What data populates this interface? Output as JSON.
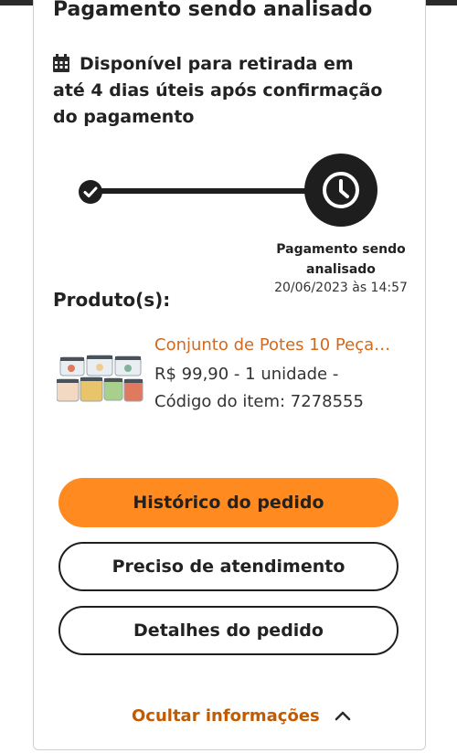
{
  "status": {
    "title": "Pagamento sendo analisado",
    "availability": "Disponível para retirada em até 4 dias úteis após confirmação do pagamento"
  },
  "tracker": {
    "current_step_label": "Pagamento sendo analisado",
    "current_step_date": "20/06/2023 às 14:57"
  },
  "products": {
    "heading": "Produto(s):",
    "items": [
      {
        "name": "Conjunto de Potes 10 Peças...",
        "details": "R$ 99,90 - 1 unidade - Código do item: 7278555",
        "thumbnail": "food-containers-image"
      }
    ]
  },
  "actions": {
    "history_label": "Histórico do pedido",
    "support_label": "Preciso de atendimento",
    "details_label": "Detalhes do pedido",
    "hide_info_label": "Ocultar informações"
  },
  "colors": {
    "accent": "#ff8a1f",
    "link": "#c25a00",
    "product_link": "#d2691e",
    "dark": "#1e1e1e"
  },
  "icons": [
    "calendar-icon",
    "check-icon",
    "clock-icon",
    "chevron-up-icon"
  ]
}
